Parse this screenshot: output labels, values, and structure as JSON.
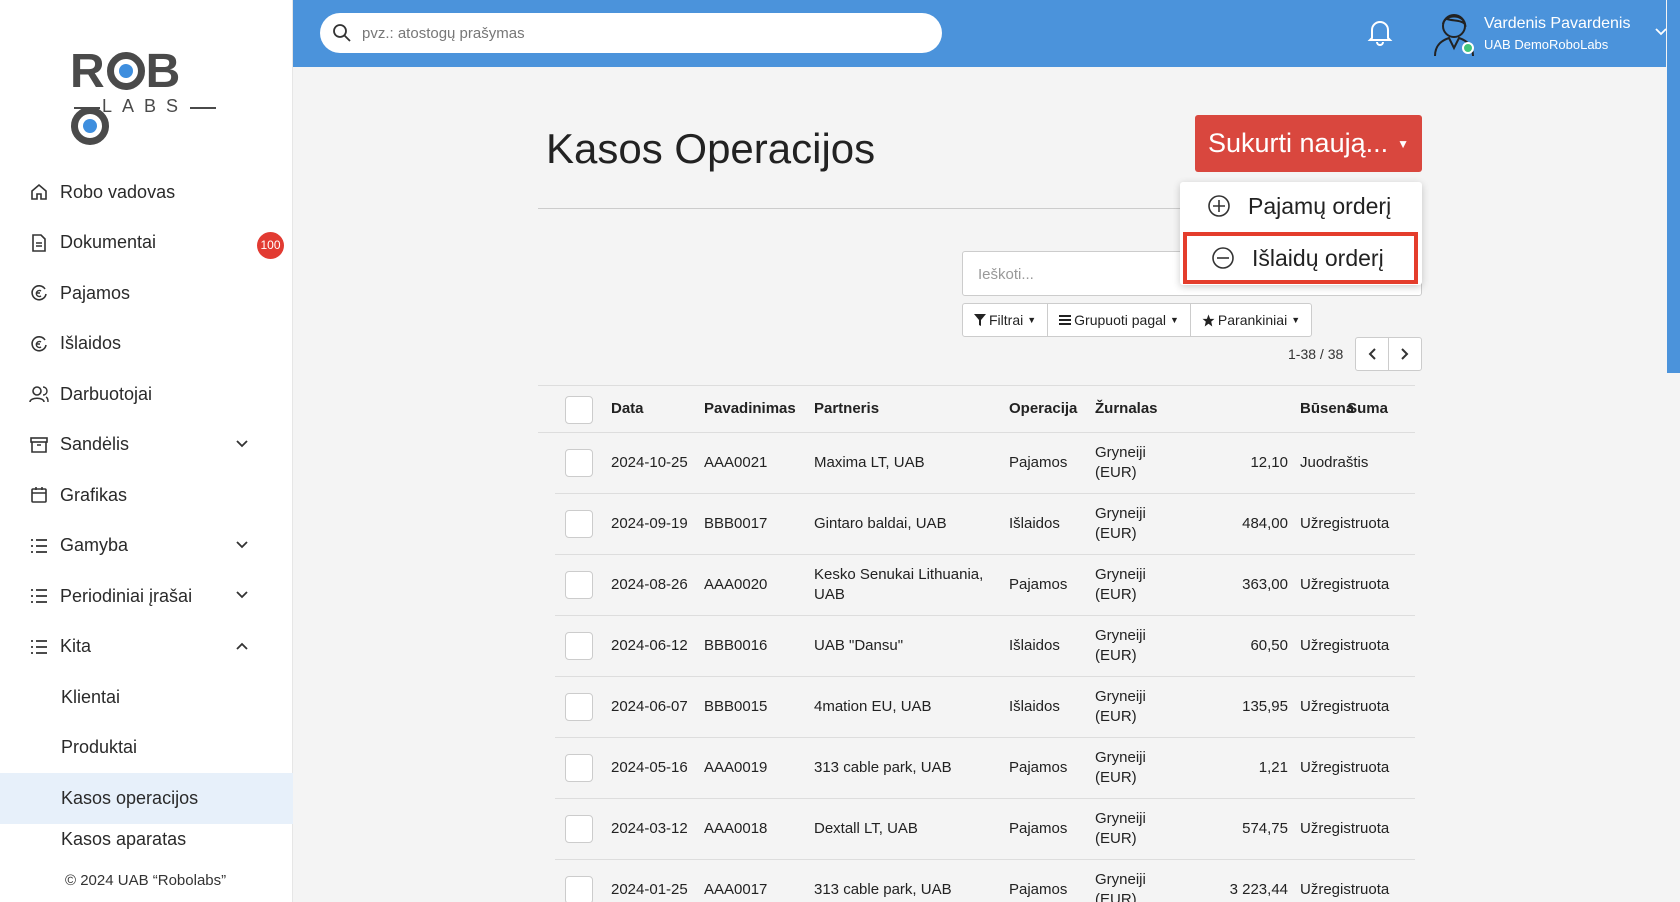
{
  "brand": {
    "logo_text": "ROBO LABS"
  },
  "sidebar": {
    "items": [
      {
        "label": "Robo vadovas",
        "icon": "home-icon"
      },
      {
        "label": "Dokumentai",
        "icon": "document-icon",
        "badge": "100"
      },
      {
        "label": "Pajamos",
        "icon": "income-icon"
      },
      {
        "label": "Išlaidos",
        "icon": "expense-icon"
      },
      {
        "label": "Darbuotojai",
        "icon": "users-icon"
      },
      {
        "label": "Sandėlis",
        "icon": "archive-icon",
        "expandable": true
      },
      {
        "label": "Grafikas",
        "icon": "calendar-icon"
      },
      {
        "label": "Gamyba",
        "icon": "list-icon",
        "expandable": true
      },
      {
        "label": "Periodiniai įrašai",
        "icon": "list-icon",
        "expandable": true
      },
      {
        "label": "Kita",
        "icon": "list-icon",
        "expanded": true
      }
    ],
    "sub_items": [
      "Klientai",
      "Produktai",
      "Kasos operacijos",
      "Kasos aparatas"
    ],
    "active_sub_item": "Kasos operacijos",
    "copyright": "© 2024 UAB “Robolabs”"
  },
  "topbar": {
    "search_placeholder": "pvz.: atostogų prašymas",
    "user_name": "Vardenis Pavardenis",
    "user_company": "UAB DemoRoboLabs"
  },
  "page": {
    "title": "Kasos Operacijos",
    "create_button": "Sukurti naują...",
    "create_menu": [
      "Pajamų orderį",
      "Išlaidų orderį"
    ],
    "highlighted_menu_item": "Išlaidų orderį",
    "search_placeholder": "Ieškoti...",
    "filters": [
      "Filtrai",
      "Grupuoti pagal",
      "Parankiniai"
    ],
    "pager": "1-38 / 38"
  },
  "table": {
    "headers": [
      "Data",
      "Pavadinimas",
      "Partneris",
      "Operacija",
      "Žurnalas",
      "Suma",
      "Būsena"
    ],
    "rows": [
      {
        "date": "2024-10-25",
        "name": "AAA0021",
        "partner": "Maxima LT, UAB",
        "op": "Pajamos",
        "journal": "Gryneiji (EUR)",
        "sum": "12,10",
        "status": "Juodraštis"
      },
      {
        "date": "2024-09-19",
        "name": "BBB0017",
        "partner": "Gintaro baldai, UAB",
        "op": "Išlaidos",
        "journal": "Gryneiji (EUR)",
        "sum": "484,00",
        "status": "Užregistruota"
      },
      {
        "date": "2024-08-26",
        "name": "AAA0020",
        "partner": "Kesko Senukai Lithuania, UAB",
        "op": "Pajamos",
        "journal": "Gryneiji (EUR)",
        "sum": "363,00",
        "status": "Užregistruota"
      },
      {
        "date": "2024-06-12",
        "name": "BBB0016",
        "partner": "UAB \"Dansu\"",
        "op": "Išlaidos",
        "journal": "Gryneiji (EUR)",
        "sum": "60,50",
        "status": "Užregistruota"
      },
      {
        "date": "2024-06-07",
        "name": "BBB0015",
        "partner": "4mation EU, UAB",
        "op": "Išlaidos",
        "journal": "Gryneiji (EUR)",
        "sum": "135,95",
        "status": "Užregistruota"
      },
      {
        "date": "2024-05-16",
        "name": "AAA0019",
        "partner": "313 cable park, UAB",
        "op": "Pajamos",
        "journal": "Gryneiji (EUR)",
        "sum": "1,21",
        "status": "Užregistruota"
      },
      {
        "date": "2024-03-12",
        "name": "AAA0018",
        "partner": "Dextall LT, UAB",
        "op": "Pajamos",
        "journal": "Gryneiji (EUR)",
        "sum": "574,75",
        "status": "Užregistruota"
      },
      {
        "date": "2024-01-25",
        "name": "AAA0017",
        "partner": "313 cable park, UAB",
        "op": "Pajamos",
        "journal": "Gryneiji (EUR)",
        "sum": "3 223,44",
        "status": "Užregistruota"
      }
    ]
  },
  "colors": {
    "accent": "#4b93db",
    "primary_button": "#d9473e",
    "highlight_border": "#e43d2c",
    "badge": "#e23b32"
  }
}
